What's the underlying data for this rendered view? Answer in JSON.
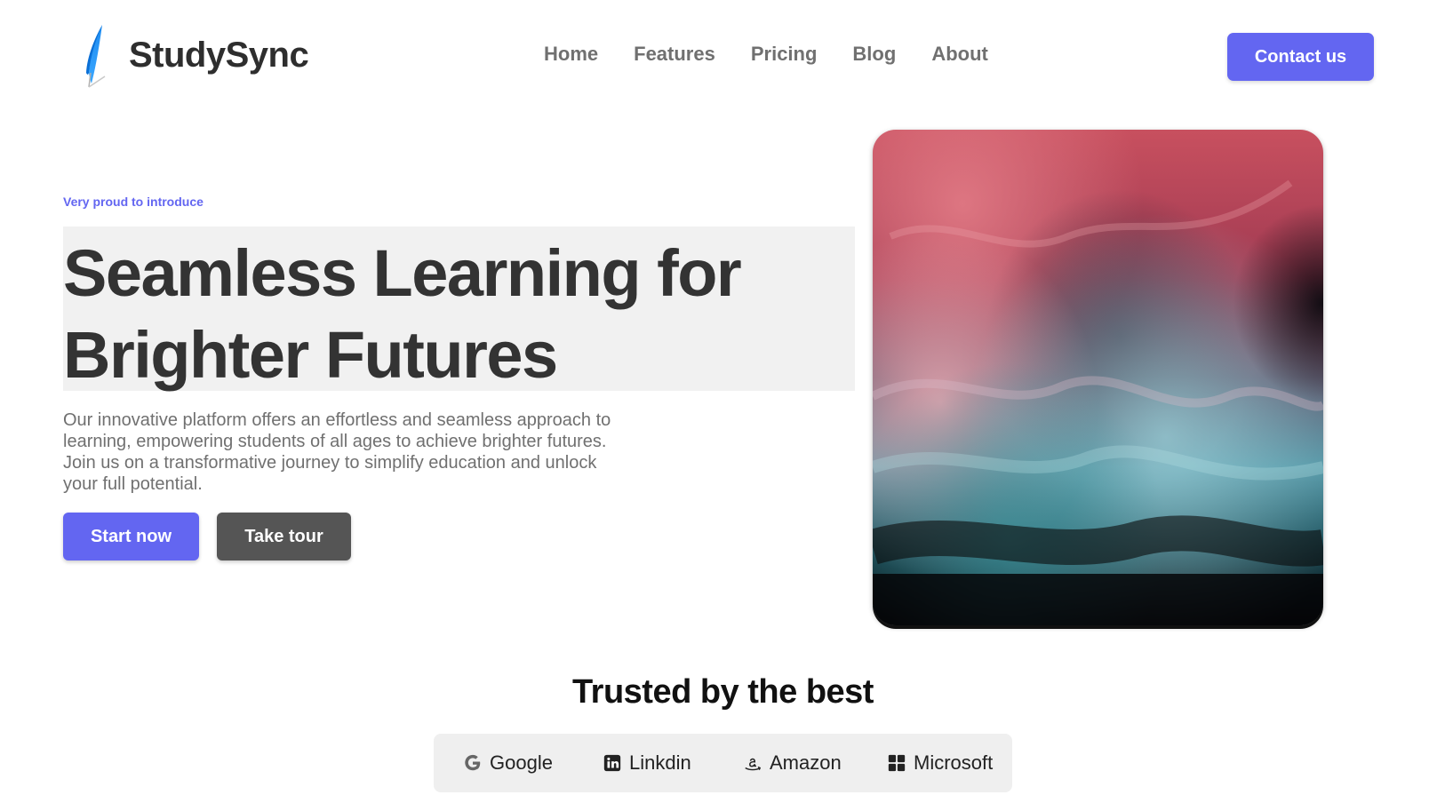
{
  "header": {
    "brand": "StudySync",
    "nav": [
      "Home",
      "Features",
      "Pricing",
      "Blog",
      "About"
    ],
    "contact_label": "Contact us"
  },
  "hero": {
    "eyebrow": "Very proud to introduce",
    "headline_line1": "Seamless Learning for",
    "headline_line2": "Brighter Futures",
    "description": "Our innovative platform offers an effortless and seamless approach to learning, empowering students of all ages to achieve brighter futures. Join us on a transformative journey to simplify education and unlock your full potential.",
    "primary_cta": "Start now",
    "secondary_cta": "Take tour"
  },
  "trusted": {
    "title": "Trusted by the best",
    "logos": [
      {
        "name": "Google",
        "icon": "google-icon"
      },
      {
        "name": "Linkdin",
        "icon": "linkedin-icon"
      },
      {
        "name": "Amazon",
        "icon": "amazon-icon"
      },
      {
        "name": "Microsoft",
        "icon": "microsoft-icon"
      }
    ]
  },
  "colors": {
    "accent": "#6366f1",
    "dark_button": "#555555",
    "heading": "#333333",
    "muted_text": "#707070"
  }
}
